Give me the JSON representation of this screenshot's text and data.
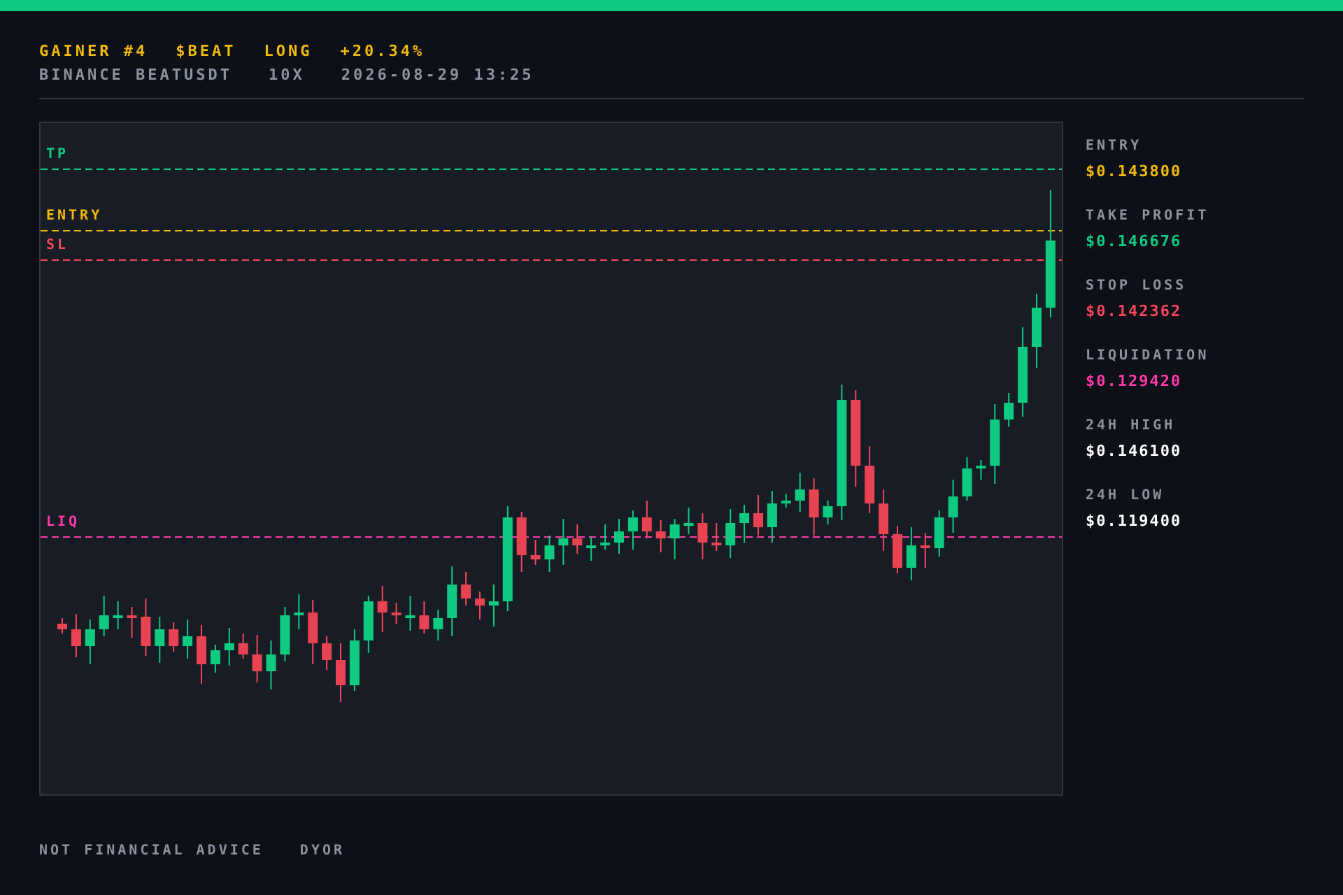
{
  "header": {
    "tags": [
      {
        "text": "GAINER #4"
      },
      {
        "text": "$BEAT"
      },
      {
        "text": "LONG"
      },
      {
        "text": "+20.34%"
      }
    ],
    "meta": [
      "BINANCE BEATUSDT",
      "10X",
      "2026-08-29 13:25"
    ]
  },
  "chart": {
    "levels": [
      {
        "kind": "tp",
        "label": "TP",
        "color": "#0ecb81"
      },
      {
        "kind": "entry",
        "label": "ENTRY",
        "color": "#f0b90b"
      },
      {
        "kind": "sl",
        "label": "SL",
        "color": "#f6465d"
      },
      {
        "kind": "liq",
        "label": "LIQ",
        "color": "#ff3aa8"
      }
    ]
  },
  "stats": [
    {
      "label": "ENTRY",
      "value": "$0.143800",
      "color": "#f0b90b"
    },
    {
      "label": "TAKE PROFIT",
      "value": "$0.146676",
      "color": "#0ecb81"
    },
    {
      "label": "STOP LOSS",
      "value": "$0.142362",
      "color": "#f6465d"
    },
    {
      "label": "LIQUIDATION",
      "value": "$0.129420",
      "color": "#ff3aa8"
    },
    {
      "label": "24H HIGH",
      "value": "$0.146100",
      "color": "#ffffff"
    },
    {
      "label": "24H LOW",
      "value": "$0.119400",
      "color": "#ffffff"
    }
  ],
  "footer": [
    "NOT FINANCIAL ADVICE",
    "DYOR"
  ]
}
